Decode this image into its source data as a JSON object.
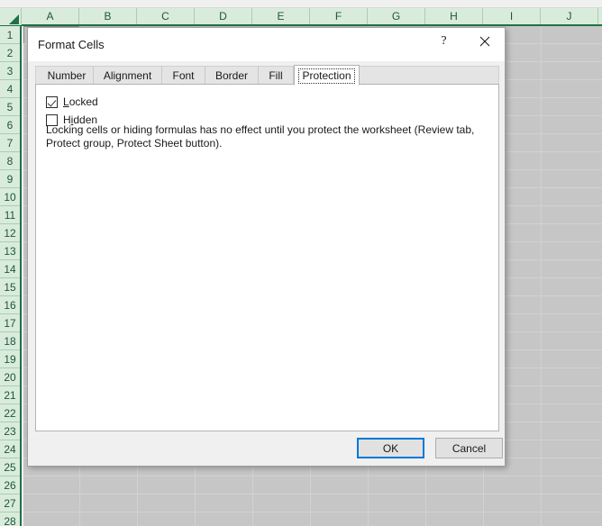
{
  "spreadsheet": {
    "columns": [
      "A",
      "B",
      "C",
      "D",
      "E",
      "F",
      "G",
      "H",
      "I",
      "J"
    ],
    "rows": [
      1,
      2,
      3,
      4,
      5,
      6,
      7,
      8,
      9,
      10,
      11,
      12,
      13,
      14,
      15,
      16,
      17,
      18,
      19,
      20,
      21,
      22,
      23,
      24,
      25,
      26,
      27,
      28
    ],
    "active_cell": "A1",
    "header_fill": "#d9ecdc",
    "header_text": "#22543b",
    "header_rule": "#1f7244",
    "dimmed_cell_fill": "#c6c6c6",
    "gridline": "#d2d2d2",
    "select_all_icon": "select-all-triangle-icon"
  },
  "dialog": {
    "title": "Format Cells",
    "help_label": "?",
    "help_icon": "help-question-icon",
    "close_label": "✕",
    "close_icon": "close-x-icon",
    "tabs": [
      {
        "label": "Number",
        "selected": false
      },
      {
        "label": "Alignment",
        "selected": false
      },
      {
        "label": "Font",
        "selected": false
      },
      {
        "label": "Border",
        "selected": false
      },
      {
        "label": "Fill",
        "selected": false
      },
      {
        "label": "Protection",
        "selected": true
      }
    ],
    "protection": {
      "locked": {
        "label": "Locked",
        "accelerator": "L",
        "label_rest": "ocked",
        "checked": true
      },
      "hidden": {
        "label": "Hidden",
        "label_pre": "H",
        "accelerator": "i",
        "label_rest": "dden",
        "checked": false
      },
      "description": "Locking cells or hiding formulas has no effect until you protect the worksheet (Review tab, Protect group, Protect Sheet button)."
    },
    "buttons": {
      "ok": "OK",
      "cancel": "Cancel"
    },
    "accent_color": "#0078d7"
  }
}
